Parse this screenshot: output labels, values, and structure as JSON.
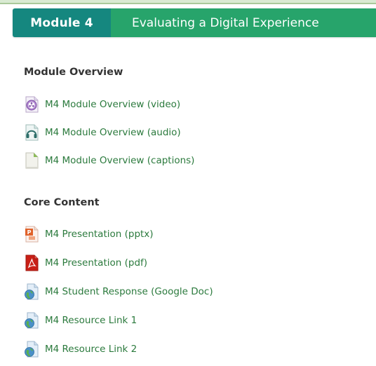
{
  "header": {
    "module_label": "Module 4",
    "module_title": "Evaluating a Digital Experience",
    "badge_color": "#15877f",
    "title_color": "#27a46b"
  },
  "sections": [
    {
      "heading": "Module Overview",
      "items": [
        {
          "label": "M4 Module Overview (video)",
          "icon": "video-file-icon"
        },
        {
          "label": "M4 Module Overview (audio)",
          "icon": "audio-file-icon"
        },
        {
          "label": "M4 Module Overview (captions)",
          "icon": "text-file-icon"
        }
      ]
    },
    {
      "heading": "Core Content",
      "items": [
        {
          "label": "M4 Presentation (pptx)",
          "icon": "powerpoint-file-icon"
        },
        {
          "label": "M4 Presentation (pdf)",
          "icon": "pdf-file-icon"
        },
        {
          "label": "M4 Student Response (Google Doc)",
          "icon": "web-link-icon"
        },
        {
          "label": "M4 Resource Link 1",
          "icon": "web-link-icon"
        },
        {
          "label": "M4 Resource Link 2",
          "icon": "web-link-icon"
        }
      ]
    }
  ],
  "link_color": "#2b7a3d"
}
